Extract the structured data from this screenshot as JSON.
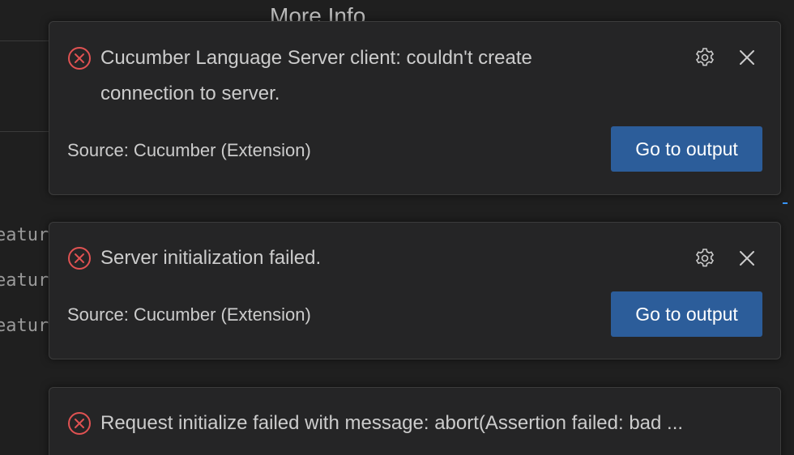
{
  "background": {
    "panel_title": "More Info",
    "code_fragments": [
      "eature",
      "eature",
      "eature"
    ]
  },
  "notifications": [
    {
      "message": "Cucumber Language Server client: couldn't create connection to server.",
      "source": "Source: Cucumber (Extension)",
      "action_label": "Go to output"
    },
    {
      "message": "Server initialization failed.",
      "source": "Source: Cucumber (Extension)",
      "action_label": "Go to output"
    },
    {
      "message": "Request initialize failed with message: abort(Assertion failed: bad ..."
    }
  ],
  "icons": {
    "error": "error-circle-x-icon",
    "settings": "gear-icon",
    "close": "close-icon"
  },
  "colors": {
    "error": "#e05252",
    "button_bg": "#2c5d9a",
    "toast_bg": "#252526",
    "background": "#1f1f1f"
  }
}
